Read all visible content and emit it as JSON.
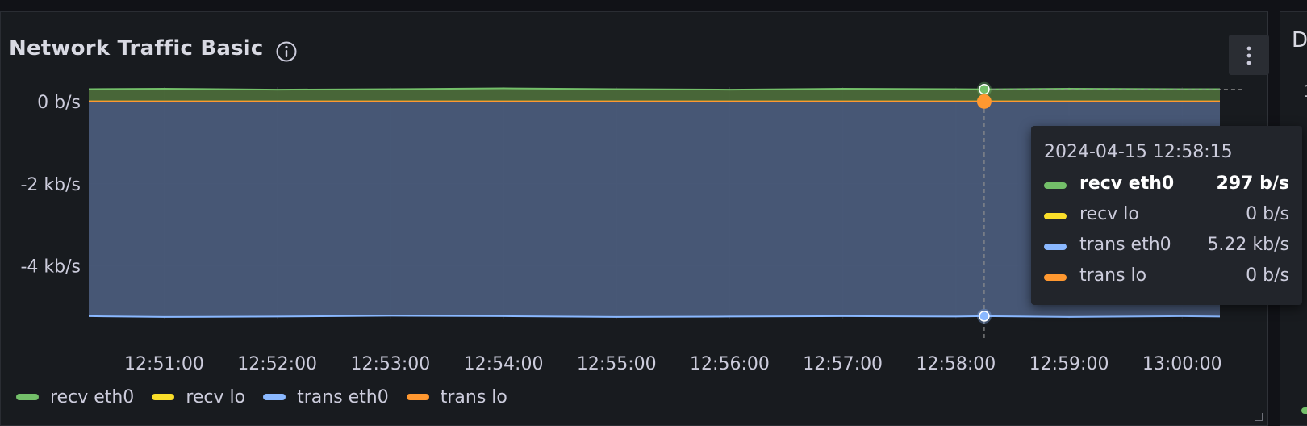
{
  "panel": {
    "title": "Network Traffic Basic",
    "info_icon": "info-circle-icon",
    "menu_icon": "vertical-ellipsis-icon",
    "resize_icon": "resize-corner-icon"
  },
  "right_panel": {
    "title_fragment": "D",
    "value_fragment": "1"
  },
  "colors": {
    "background": "#111217",
    "panel": "#181b1f",
    "recv_eth0": "#73bf69",
    "recv_lo": "#fade2a",
    "trans_eth0": "#8ab8ff",
    "trans_lo": "#ff9830"
  },
  "tooltip": {
    "time": "2024-04-15 12:58:15",
    "rows": [
      {
        "name": "recv eth0",
        "value": "297 b/s",
        "color": "#73bf69",
        "bold": true
      },
      {
        "name": "recv lo",
        "value": "0 b/s",
        "color": "#fade2a",
        "bold": false
      },
      {
        "name": "trans eth0",
        "value": "5.22 kb/s",
        "color": "#8ab8ff",
        "bold": false
      },
      {
        "name": "trans lo",
        "value": "0 b/s",
        "color": "#ff9830",
        "bold": false
      }
    ]
  },
  "legend": [
    {
      "name": "recv eth0",
      "color": "#73bf69"
    },
    {
      "name": "recv lo",
      "color": "#fade2a"
    },
    {
      "name": "trans eth0",
      "color": "#8ab8ff"
    },
    {
      "name": "trans lo",
      "color": "#ff9830"
    }
  ],
  "chart_data": {
    "type": "area",
    "title": "Network Traffic Basic",
    "xlabel": "",
    "ylabel": "",
    "y_unit": "b/s",
    "ylim": [
      -5.3,
      0.35
    ],
    "y_ticks": [
      {
        "value": 0,
        "label": "0 b/s"
      },
      {
        "value": -2,
        "label": "-2 kb/s"
      },
      {
        "value": -4,
        "label": "-4 kb/s"
      }
    ],
    "xlim": [
      "12:50:20",
      "13:00:20"
    ],
    "x_ticks": [
      "12:51:00",
      "12:52:00",
      "12:53:00",
      "12:54:00",
      "12:55:00",
      "12:56:00",
      "12:57:00",
      "12:58:00",
      "12:59:00",
      "13:00:00"
    ],
    "grid": true,
    "legend_position": "bottom-left",
    "hover_time": "12:58:15",
    "series": [
      {
        "name": "recv eth0",
        "unit_note": "kb/s",
        "x": [
          "12:50:20",
          "12:51:00",
          "12:52:00",
          "12:53:00",
          "12:54:00",
          "12:55:00",
          "12:56:00",
          "12:57:00",
          "12:58:00",
          "12:58:15",
          "12:59:00",
          "13:00:00",
          "13:00:20"
        ],
        "values": [
          0.3,
          0.31,
          0.29,
          0.3,
          0.32,
          0.3,
          0.29,
          0.31,
          0.3,
          0.297,
          0.31,
          0.3,
          0.3
        ]
      },
      {
        "name": "recv lo",
        "x": [
          "12:50:20",
          "13:00:20"
        ],
        "values": [
          0,
          0
        ]
      },
      {
        "name": "trans eth0",
        "x": [
          "12:50:20",
          "12:51:00",
          "12:52:00",
          "12:53:00",
          "12:54:00",
          "12:55:00",
          "12:56:00",
          "12:57:00",
          "12:58:00",
          "12:58:15",
          "12:59:00",
          "13:00:00",
          "13:00:20"
        ],
        "values": [
          -5.22,
          -5.24,
          -5.23,
          -5.21,
          -5.22,
          -5.24,
          -5.23,
          -5.22,
          -5.23,
          -5.22,
          -5.24,
          -5.22,
          -5.23
        ]
      },
      {
        "name": "trans lo",
        "x": [
          "12:50:20",
          "13:00:20"
        ],
        "values": [
          0,
          0
        ]
      }
    ]
  }
}
